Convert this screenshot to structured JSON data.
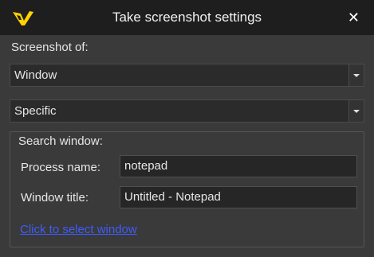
{
  "window": {
    "title": "Take screenshot settings",
    "close_glyph": "✕",
    "logo_icon": "app-logo-icon",
    "close_icon": "close-icon"
  },
  "form": {
    "screenshot_of_label": "Screenshot of:",
    "target_select": {
      "value": "Window"
    },
    "mode_select": {
      "value": "Specific"
    },
    "search_group": {
      "title": "Search window:",
      "process_name_label": "Process name:",
      "process_name_value": "notepad",
      "window_title_label": "Window title:",
      "window_title_value": "Untitled - Notepad",
      "select_link": "Click to select window"
    }
  },
  "colors": {
    "title_bar": "#1e1e1e",
    "background": "#3a3a3a",
    "logo": "#ffd200",
    "link": "#3d5cff"
  }
}
